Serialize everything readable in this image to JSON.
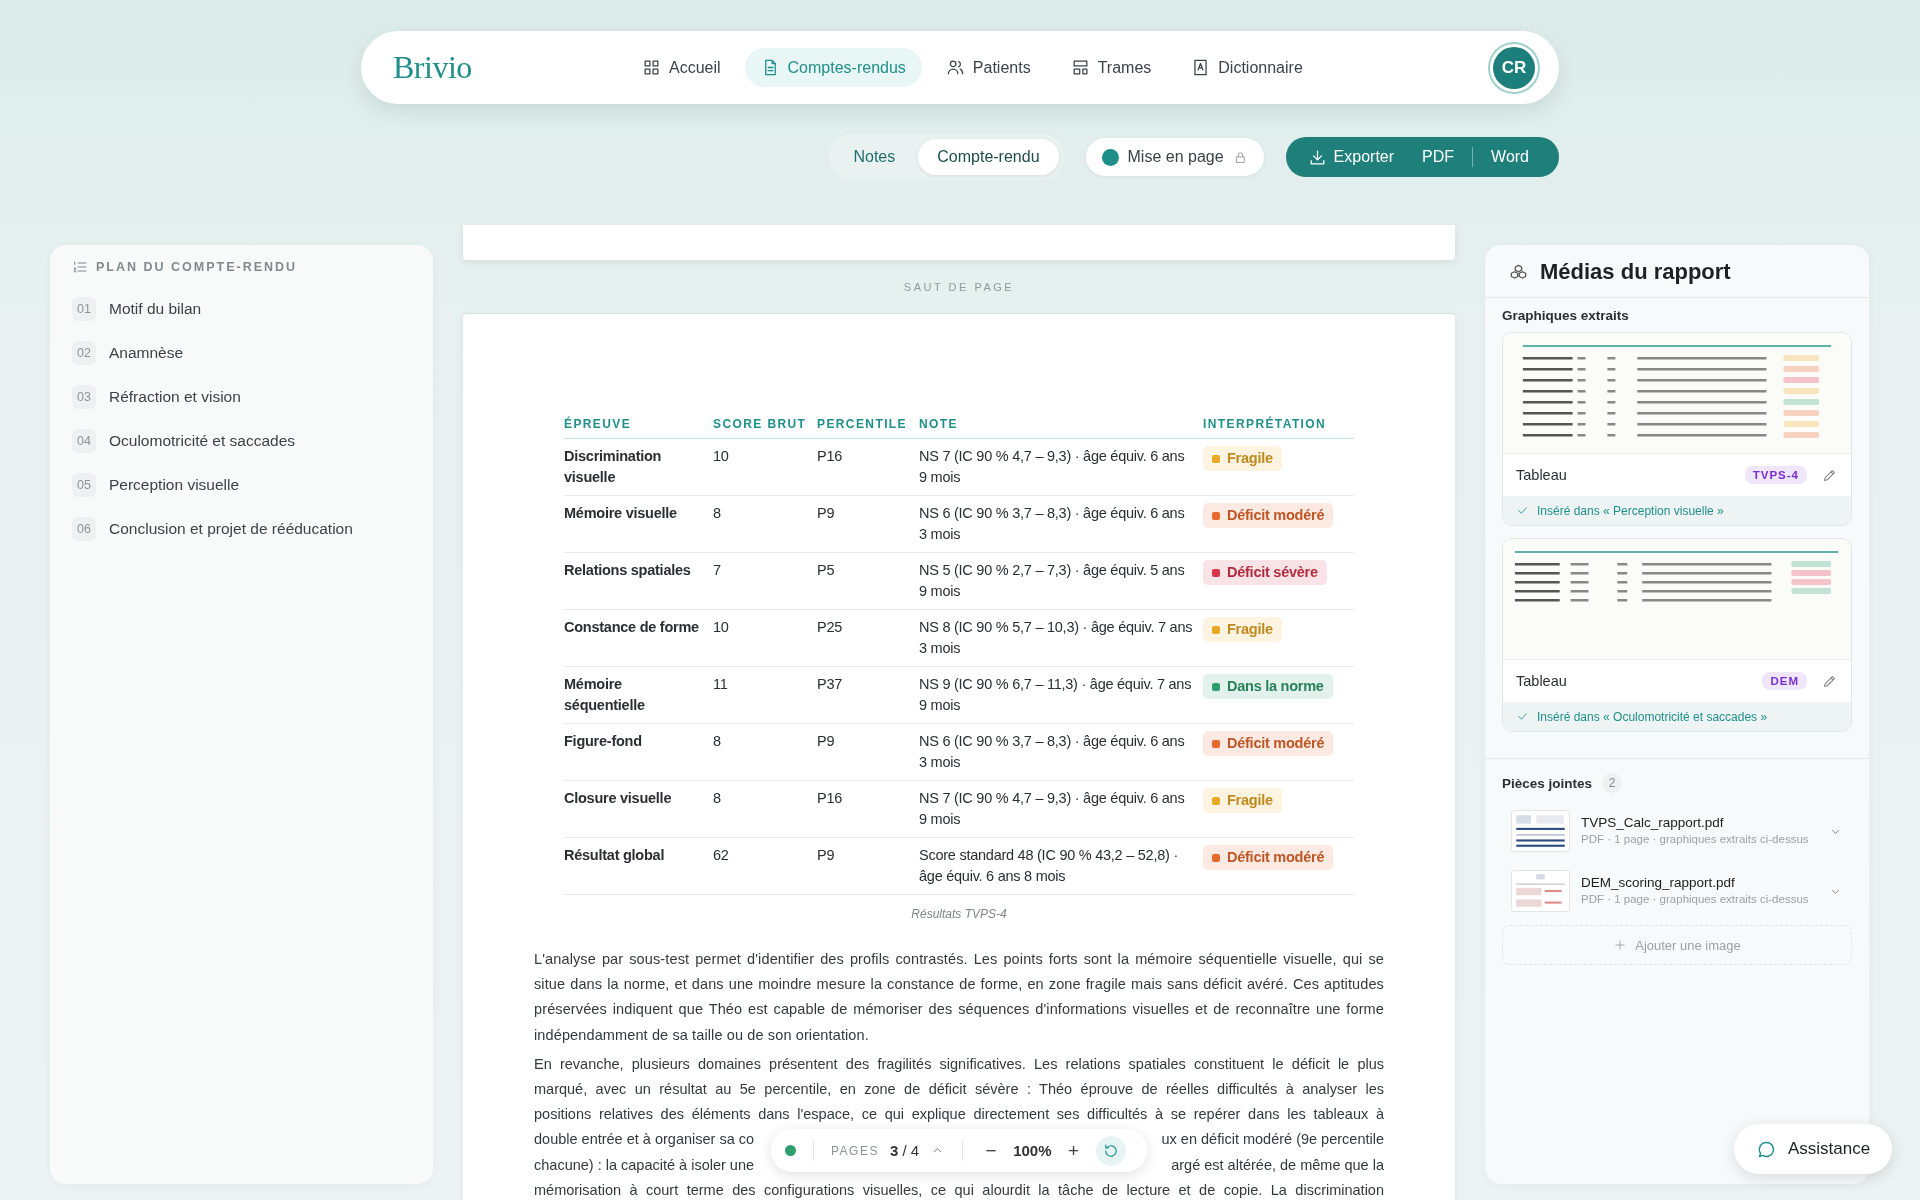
{
  "nav": {
    "logo": "Brivio",
    "avatar": "CR",
    "items": [
      {
        "label": "Accueil",
        "selected": false
      },
      {
        "label": "Comptes-rendus",
        "selected": true
      },
      {
        "label": "Patients",
        "selected": false
      },
      {
        "label": "Trames",
        "selected": false
      },
      {
        "label": "Dictionnaire",
        "selected": false
      }
    ]
  },
  "view_toggle": [
    {
      "label": "Notes",
      "selected": false
    },
    {
      "label": "Compte-rendu",
      "selected": true
    }
  ],
  "layout_toggle": {
    "label": "Mise en page",
    "on": true,
    "locked": true
  },
  "export": {
    "label": "Exporter",
    "formats": [
      "PDF",
      "Word"
    ]
  },
  "outline": {
    "title": "PLAN DU COMPTE-RENDU",
    "items": [
      {
        "number": "01",
        "label": "Motif du bilan"
      },
      {
        "number": "02",
        "label": "Anamnèse"
      },
      {
        "number": "03",
        "label": "Réfraction et vision"
      },
      {
        "number": "04",
        "label": "Oculomotricité et saccades"
      },
      {
        "number": "05",
        "label": "Perception visuelle"
      },
      {
        "number": "06",
        "label": "Conclusion et projet de rééducation"
      }
    ]
  },
  "document": {
    "page_break": "SAUT DE PAGE",
    "table": {
      "columns": [
        "ÉPREUVE",
        "SCORE BRUT",
        "PERCENTILE",
        "NOTE",
        "INTERPRÉTATION"
      ],
      "rows": [
        {
          "cells": [
            "Discrimination visuelle",
            "10",
            "P16",
            "NS 7 (IC 90 % 4,7 – 9,3) · âge équiv. 6 ans 9 mois"
          ],
          "interpretation": {
            "label": "Fragile",
            "color": "#e9a825"
          }
        },
        {
          "cells": [
            "Mémoire visuelle",
            "8",
            "P9",
            "NS 6 (IC 90 % 3,7 – 8,3) · âge équiv. 6 ans 3 mois"
          ],
          "interpretation": {
            "label": "Déficit modéré",
            "color": "#e8692e"
          }
        },
        {
          "cells": [
            "Relations spatiales",
            "7",
            "P5",
            "NS 5 (IC 90 % 2,7 – 7,3) · âge équiv. 5 ans 9 mois"
          ],
          "interpretation": {
            "label": "Déficit sévère",
            "color": "#d9364a"
          }
        },
        {
          "cells": [
            "Constance de forme",
            "10",
            "P25",
            "NS 8 (IC 90 % 5,7 – 10,3) · âge équiv. 7 ans 3 mois"
          ],
          "interpretation": {
            "label": "Fragile",
            "color": "#e9a825"
          }
        },
        {
          "cells": [
            "Mémoire séquentielle",
            "11",
            "P37",
            "NS 9 (IC 90 % 6,7 – 11,3) · âge équiv. 7 ans 9 mois"
          ],
          "interpretation": {
            "label": "Dans la norme",
            "color": "#2f9e6e"
          }
        },
        {
          "cells": [
            "Figure-fond",
            "8",
            "P9",
            "NS 6 (IC 90 % 3,7 – 8,3) · âge équiv. 6 ans 3 mois"
          ],
          "interpretation": {
            "label": "Déficit modéré",
            "color": "#e8692e"
          }
        },
        {
          "cells": [
            "Closure visuelle",
            "8",
            "P16",
            "NS 7 (IC 90 % 4,7 – 9,3) · âge équiv. 6 ans 9 mois"
          ],
          "interpretation": {
            "label": "Fragile",
            "color": "#e9a825"
          }
        },
        {
          "cells": [
            "Résultat global",
            "62",
            "P9",
            "Score standard 48 (IC 90 % 43,2 – 52,8) · âge équiv. 6 ans 8 mois"
          ],
          "interpretation": {
            "label": "Déficit modéré",
            "color": "#e8692e"
          }
        }
      ],
      "caption": "Résultats TVPS-4"
    },
    "paragraph": "L'analyse par sous-test permet d'identifier des profils contrastés. Les points forts sont la mémoire séquentielle visuelle, qui se situe dans la norme, et dans une moindre mesure la constance de forme, en zone fragile mais sans déficit avéré. Ces aptitudes préservées indiquent que Théo est capable de mémoriser des séquences d'informations visuelles et de reconnaître une forme indépendamment de sa taille ou de son orientation.",
    "paragraph_2_lines": [
      {
        "left": "En revanche, plusieurs domaines présentent des fragilités significatives. Les relations spatiales constituent le déficit le plus"
      },
      {
        "left": "marqué, avec un résultat au 5e percentile, en zone de déficit sévère : Théo éprouve de réelles difficultés à analyser les"
      },
      {
        "left": "positions relatives des éléments dans l'espace, ce qui explique directement ses difficultés à se repérer dans les tableaux à"
      },
      {
        "left": "double entrée et à organiser sa co",
        "right": "ux en déficit modéré (9e percentile"
      },
      {
        "left": "chacune) : la capacité à isoler une",
        "right": "argé est altérée, de même que la"
      },
      {
        "left": "mémorisation à court terme des configurations visuelles, ce qui alourdit la tâche de lecture et de copie. La discrimination"
      }
    ]
  },
  "pager": {
    "label": "PAGES",
    "page": "**3** / 4",
    "zoom_out": "−",
    "zoom": "100%",
    "zoom_in": "+"
  },
  "media": {
    "title": "Médias du rapport",
    "section": "Graphiques extraits",
    "items": [
      {
        "label": "Tableau",
        "tag": "TVPS-4",
        "inserted": "Inséré dans « Perception visuelle »"
      },
      {
        "label": "Tableau",
        "tag": "DEM",
        "inserted": "Inséré dans « Oculomotricité et saccades »"
      }
    ],
    "attachments_title": "Pièces jointes",
    "attachments_count": "2",
    "attachments": [
      {
        "name": "TVPS_Calc_rapport.pdf",
        "meta": "PDF · 1 page · graphiques extraits ci-dessus"
      },
      {
        "name": "DEM_scoring_rapport.pdf",
        "meta": "PDF · 1 page · graphiques extraits ci-dessus"
      }
    ],
    "add_image": "Ajouter une image"
  },
  "assistance": "Assistance"
}
